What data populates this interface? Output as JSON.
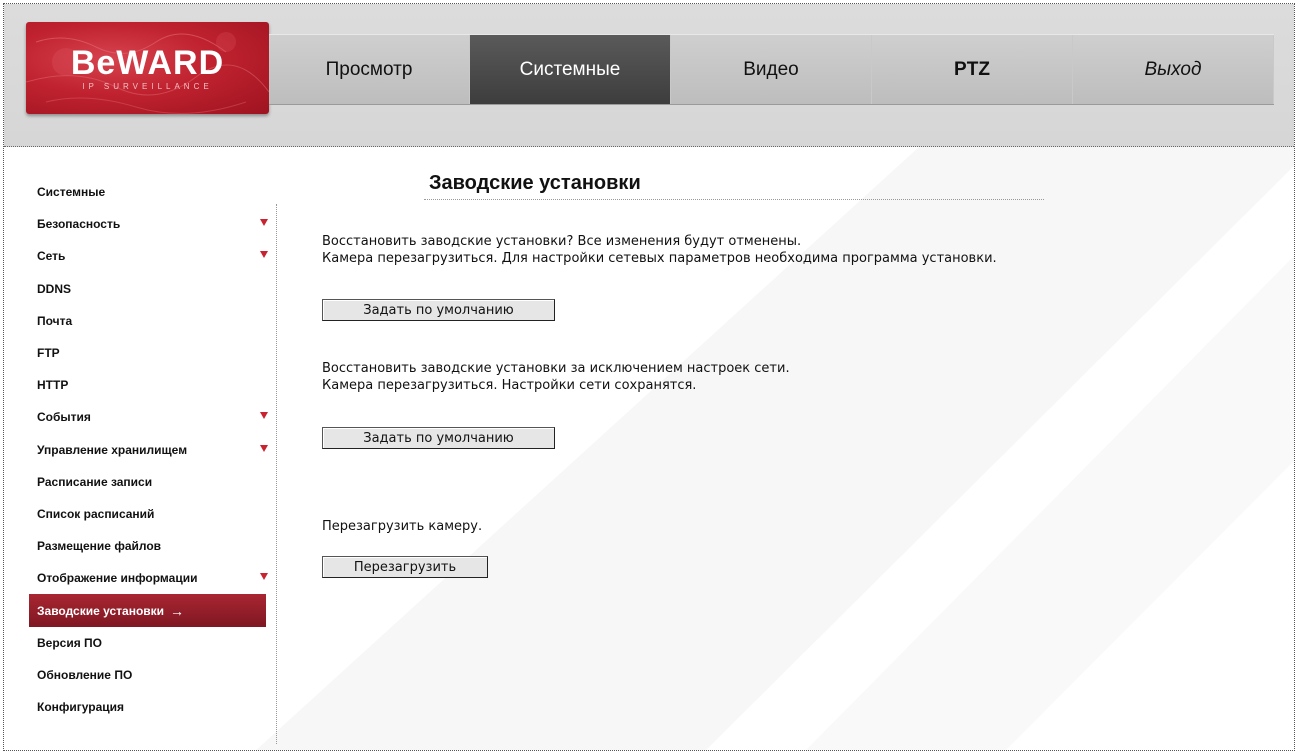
{
  "brand": {
    "logo_text": "BeWARD",
    "logo_sub": "IP SURVEILLANCE"
  },
  "nav": {
    "items": [
      {
        "label": "Просмотр"
      },
      {
        "label": "Системные"
      },
      {
        "label": "Видео"
      },
      {
        "label": "PTZ"
      },
      {
        "label": "Выход"
      }
    ],
    "active": "Системные"
  },
  "sidebar": {
    "items": [
      {
        "label": "Системные"
      },
      {
        "label": "Безопасность"
      },
      {
        "label": "Сеть"
      },
      {
        "label": "DDNS"
      },
      {
        "label": "Почта"
      },
      {
        "label": "FTP"
      },
      {
        "label": "HTTP"
      },
      {
        "label": "События"
      },
      {
        "label": "Управление хранилищем"
      },
      {
        "label": "Расписание записи"
      },
      {
        "label": "Список расписаний"
      },
      {
        "label": "Размещение файлов"
      },
      {
        "label": "Отображение информации"
      },
      {
        "label": "Заводские установки"
      },
      {
        "label": "Версия ПО"
      },
      {
        "label": "Обновление ПО"
      },
      {
        "label": "Конфигурация"
      }
    ],
    "active_arrow": "→"
  },
  "main": {
    "title": "Заводские установки",
    "section1": {
      "line1": "Восстановить заводские установки? Все изменения будут отменены.",
      "line2": "Камера перезагрузиться. Для настройки сетевых параметров необходима программа установки.",
      "button": "Задать по умолчанию"
    },
    "section2": {
      "line1": "Восстановить заводские установки за исключением настроек сети.",
      "line2": "Камера перезагрузиться. Настройки сети сохранятся.",
      "button": "Задать по умолчанию"
    },
    "section3": {
      "line1": "Перезагрузить камеру.",
      "button": "Перезагрузить"
    }
  },
  "colors": {
    "brand_red": "#c0222f",
    "active_nav": "#4a4a4a",
    "active_side": "#a82632",
    "arrow_red": "#c8232f"
  }
}
